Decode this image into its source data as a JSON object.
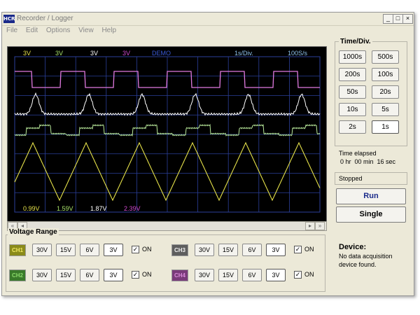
{
  "window": {
    "app_icon_text": "HCR",
    "title": "Recorder / Logger",
    "min_glyph": "_",
    "max_glyph": "□",
    "close_glyph": "×"
  },
  "menu": [
    "File",
    "Edit",
    "Options",
    "View",
    "Help"
  ],
  "scope": {
    "top_readouts": [
      {
        "text": "3V",
        "color": "#e6e24a"
      },
      {
        "text": "3V",
        "color": "#a8e26a"
      },
      {
        "text": "3V",
        "color": "#ffffff"
      },
      {
        "text": "3V",
        "color": "#d24ad2"
      },
      {
        "text": "DEMO",
        "color": "#3a5ad8"
      },
      {
        "text": "1s/Div.",
        "color": "#8ec2ec"
      },
      {
        "text": "100S/s",
        "color": "#8ec2ec"
      }
    ],
    "bottom_readouts": [
      {
        "text": "0.99V",
        "color": "#e6e24a"
      },
      {
        "text": "1.59V",
        "color": "#a8e26a"
      },
      {
        "text": "1.87V",
        "color": "#ffffff"
      },
      {
        "text": "2.39V",
        "color": "#d24ad2"
      }
    ],
    "grid_color": "#2b3f9a",
    "trace_colors": {
      "ch1": "#e6e24a",
      "ch2": "#b8e89a",
      "ch3": "#ffffff",
      "ch4": "#e07ae0"
    }
  },
  "scrollbar": {
    "left_far": "«",
    "left": "◂",
    "right": "▸",
    "right_far": "»"
  },
  "time_div": {
    "label": "Time/Div.",
    "buttons": [
      {
        "label": "1000s",
        "selected": false
      },
      {
        "label": "500s",
        "selected": false
      },
      {
        "label": "200s",
        "selected": false
      },
      {
        "label": "100s",
        "selected": false
      },
      {
        "label": "50s",
        "selected": false
      },
      {
        "label": "20s",
        "selected": false
      },
      {
        "label": "10s",
        "selected": false
      },
      {
        "label": "5s",
        "selected": false
      },
      {
        "label": "2s",
        "selected": false
      },
      {
        "label": "1s",
        "selected": true
      }
    ]
  },
  "elapsed": {
    "label": "Time elapsed",
    "value": "0 hr  00 min  16 sec"
  },
  "status": "Stopped",
  "run_label": "Run",
  "single_label": "Single",
  "voltage": {
    "label": "Voltage Range",
    "ranges": [
      "30V",
      "15V",
      "6V",
      "3V"
    ],
    "on_label": "ON",
    "check_glyph": "✓",
    "channels": [
      {
        "name": "CH1",
        "bg": "#8a8a1a",
        "fg": "#f0e860",
        "selected": "3V",
        "on": true
      },
      {
        "name": "CH2",
        "bg": "#3a7a2a",
        "fg": "#8ad86a",
        "selected": "3V",
        "on": true
      },
      {
        "name": "CH3",
        "bg": "#5e5e5e",
        "fg": "#f0f0f0",
        "selected": "3V",
        "on": true
      },
      {
        "name": "CH4",
        "bg": "#7a3a7a",
        "fg": "#d88ad8",
        "selected": "3V",
        "on": true
      }
    ]
  },
  "device": {
    "label": "Device:",
    "text": "No data acquisition device found."
  }
}
